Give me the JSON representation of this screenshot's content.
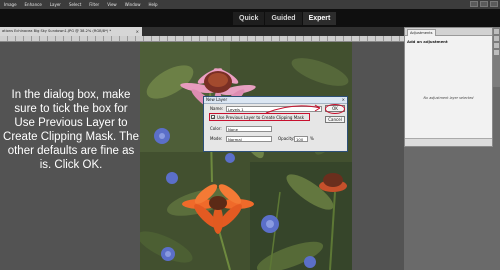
{
  "menu": {
    "items": [
      "Image",
      "Enhance",
      "Layer",
      "Select",
      "Filter",
      "View",
      "Window",
      "Help"
    ]
  },
  "modebar": {
    "tabs": [
      {
        "label": "Quick",
        "active": false
      },
      {
        "label": "Guided",
        "active": false
      },
      {
        "label": "Expert",
        "active": true
      }
    ]
  },
  "document": {
    "tab_title": "ations Echinacea Big Sky Sundown1.JPG @ 38.2% (RGB/8*) *"
  },
  "instruction": {
    "text": "In the dialog box, make sure to tick the box for Use Previous Layer to Create Clipping Mask. The other defaults are fine as is. Click OK."
  },
  "dialog": {
    "title": "New Layer",
    "name_label": "Name:",
    "name_value": "Levels 1",
    "checkbox_label": "Use Previous Layer to Create Clipping Mask",
    "checkbox_checked": true,
    "color_label": "Color:",
    "color_value": "None",
    "mode_label": "Mode:",
    "mode_value": "Normal",
    "opacity_label": "Opacity:",
    "opacity_value": "100",
    "opacity_unit": "%",
    "ok_label": "OK",
    "cancel_label": "Cancel",
    "highlight_color": "#c8102e"
  },
  "adjustments_panel": {
    "tab_label": "Adjustments",
    "heading": "Add an adjustment",
    "empty_message": "No adjustment layer selected"
  }
}
